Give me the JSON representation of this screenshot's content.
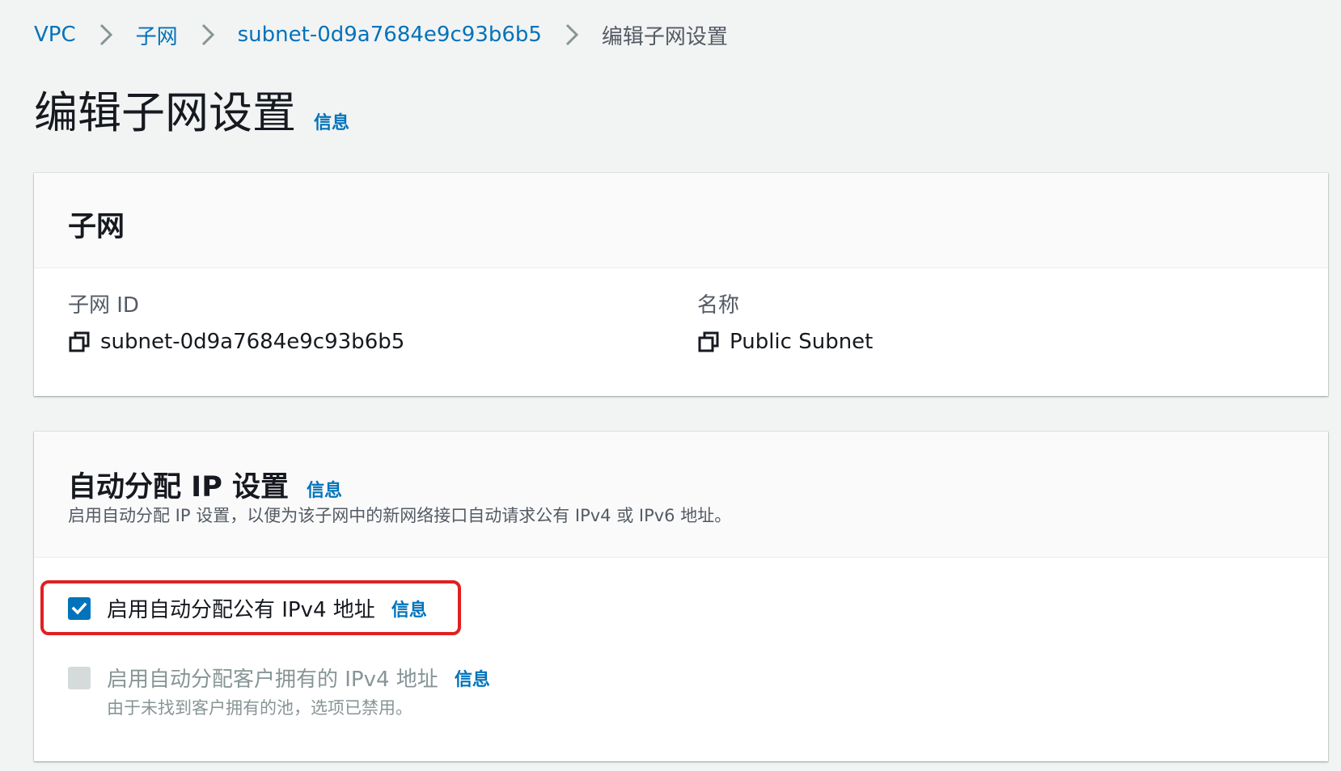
{
  "breadcrumb": {
    "items": [
      "VPC",
      "子网",
      "subnet-0d9a7684e9c93b6b5"
    ],
    "current": "编辑子网设置"
  },
  "page": {
    "title": "编辑子网设置",
    "info": "信息"
  },
  "subnet_panel": {
    "title": "子网",
    "fields": [
      {
        "label": "子网 ID",
        "value": "subnet-0d9a7684e9c93b6b5",
        "icon": "copy-icon"
      },
      {
        "label": "名称",
        "value": "Public Subnet",
        "icon": "copy-icon"
      }
    ]
  },
  "ip_panel": {
    "title": "自动分配 IP 设置",
    "info": "信息",
    "description": "启用自动分配 IP 设置，以便为该子网中的新网络接口自动请求公有 IPv4 或 IPv6 地址。",
    "options": [
      {
        "label": "启用自动分配公有 IPv4 地址",
        "info": "信息",
        "checked": true,
        "disabled": false
      },
      {
        "label": "启用自动分配客户拥有的 IPv4 地址",
        "info": "信息",
        "checked": false,
        "disabled": true,
        "hint": "由于未找到客户拥有的池，选项已禁用。"
      }
    ]
  },
  "colors": {
    "link": "#0073bb",
    "highlight": "#e02020",
    "background": "#f2f3f3"
  }
}
